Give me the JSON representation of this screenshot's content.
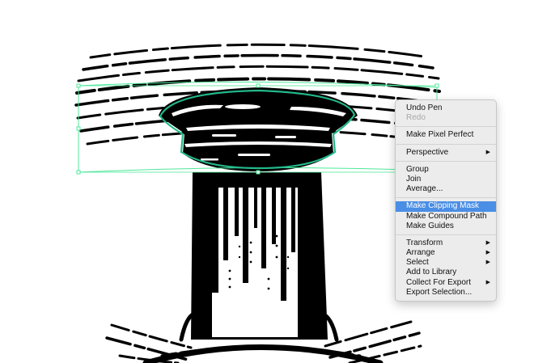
{
  "context_menu": {
    "groups": [
      [
        {
          "label": "Undo Pen",
          "disabled": false
        },
        {
          "label": "Redo",
          "disabled": true
        }
      ],
      [
        {
          "label": "Make Pixel Perfect"
        }
      ],
      [
        {
          "label": "Perspective",
          "submenu": true
        }
      ],
      [
        {
          "label": "Group"
        },
        {
          "label": "Join"
        },
        {
          "label": "Average..."
        }
      ],
      [
        {
          "label": "Make Clipping Mask",
          "highlighted": true
        },
        {
          "label": "Make Compound Path"
        },
        {
          "label": "Make Guides"
        }
      ],
      [
        {
          "label": "Transform",
          "submenu": true
        },
        {
          "label": "Arrange",
          "submenu": true
        },
        {
          "label": "Select",
          "submenu": true
        },
        {
          "label": "Add to Library"
        },
        {
          "label": "Collect For Export",
          "submenu": true
        },
        {
          "label": "Export Selection..."
        }
      ]
    ],
    "submenu_arrow": "▶",
    "highlight_color": "#4a8ee5"
  },
  "canvas": {
    "selection_color": "#4ee89a",
    "path_color": "#23b88a",
    "ink_color": "#000000"
  }
}
